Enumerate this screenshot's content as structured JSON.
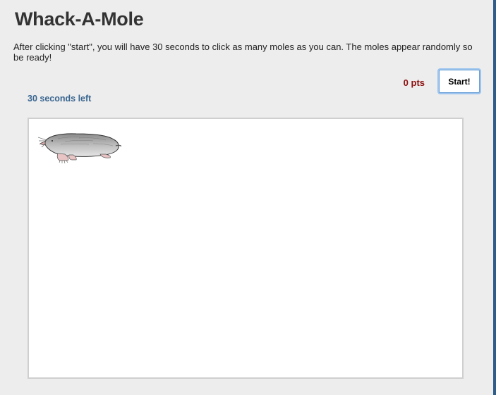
{
  "game": {
    "title": "Whack-A-Mole",
    "instructions": "After clicking \"start\", you will have 30 seconds to click as many moles as you can. The moles appear randomly so be ready!",
    "score_label": "0 pts",
    "start_label": "Start!",
    "timer_label": "30 seconds left"
  },
  "colors": {
    "background": "#ededed",
    "score": "#8b1010",
    "timer": "#3a6690",
    "board": "#ffffff",
    "edge_accent": "#2f5d8a"
  },
  "icons": {
    "mole": "mole-icon"
  }
}
